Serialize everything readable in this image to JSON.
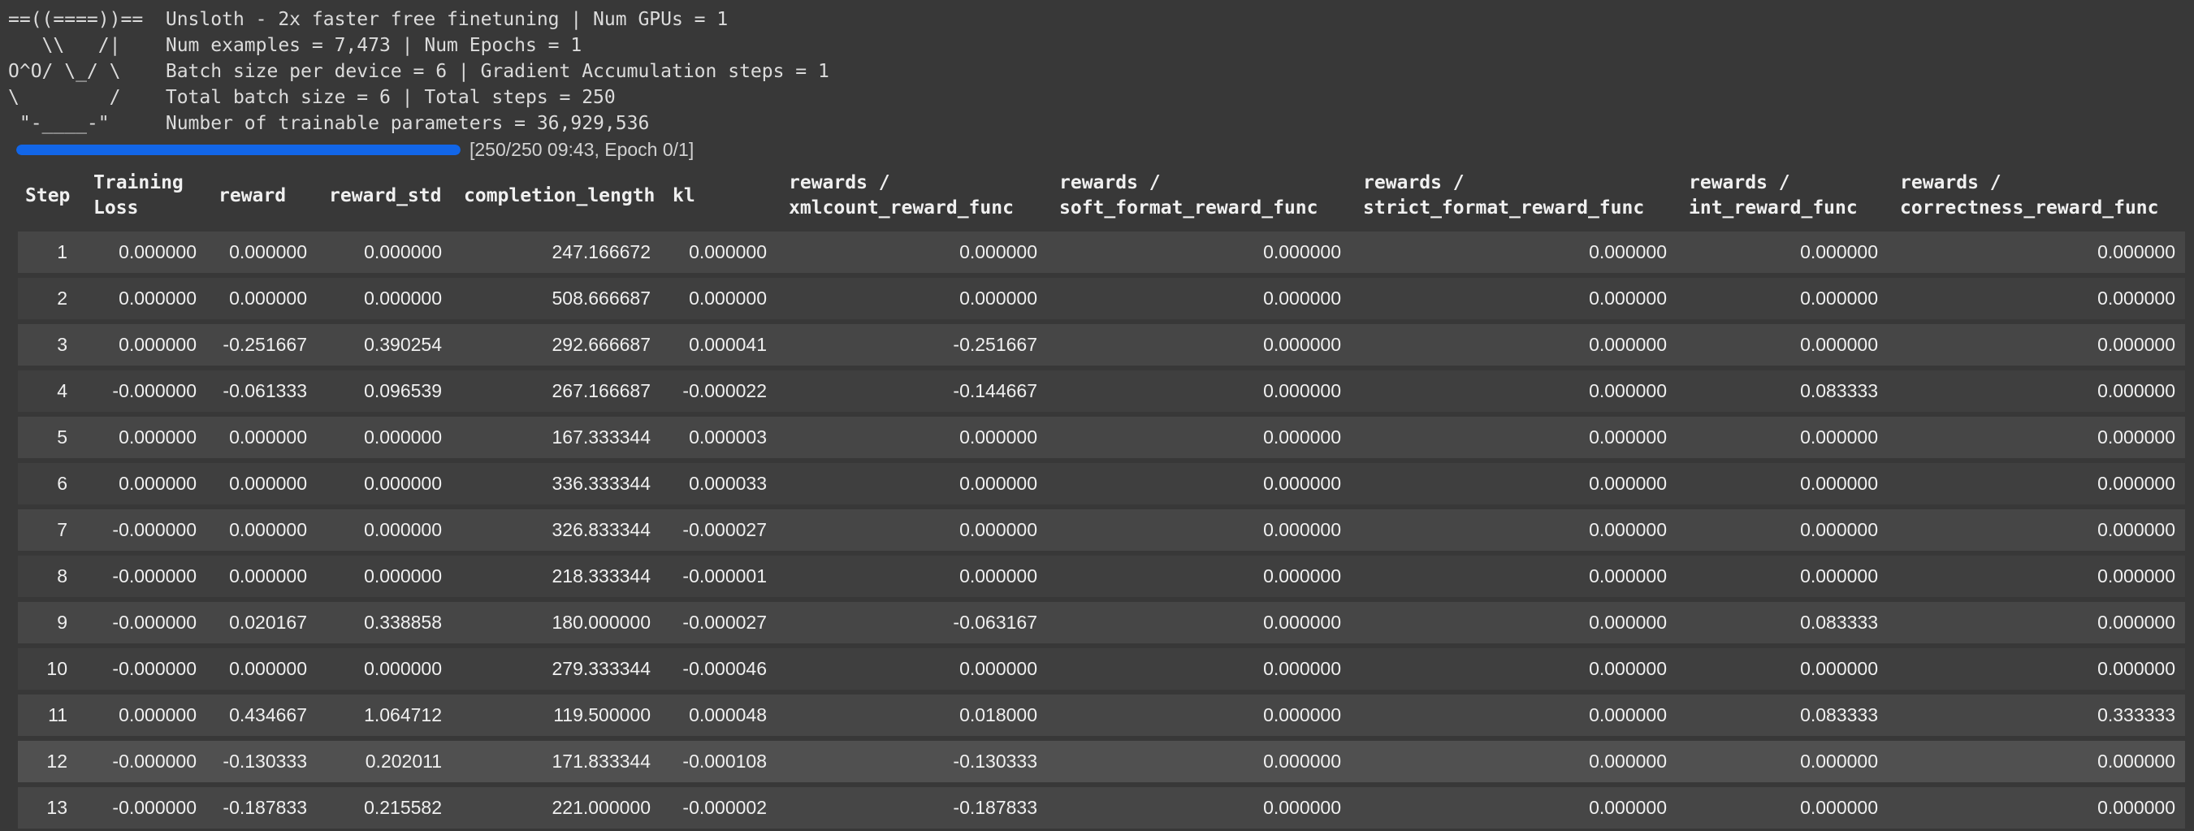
{
  "banner": {
    "ascii_art": [
      "==((====))==  Unsloth - 2x faster free finetuning | Num GPUs = 1",
      "   \\\\   /|    Num examples = 7,473 | Num Epochs = 1",
      "O^O/ \\_/ \\    Batch size per device = 6 | Gradient Accumulation steps = 1",
      "\\        /    Total batch size = 6 | Total steps = 250",
      " \"-____-\"     Number of trainable parameters = 36,929,536"
    ]
  },
  "progress": {
    "value": 250,
    "max": 250,
    "label": "[250/250 09:43, Epoch 0/1]",
    "bar_color": "#1266e8"
  },
  "table": {
    "column_keys": [
      "step",
      "training_loss",
      "reward",
      "reward_std",
      "completion_length",
      "kl",
      "rewards_xmlcount_reward_func",
      "rewards_soft_format_reward_func",
      "rewards_strict_format_reward_func",
      "rewards_int_reward_func",
      "rewards_correctness_reward_func"
    ],
    "columns": [
      {
        "label": "Step"
      },
      {
        "label": "Training\nLoss"
      },
      {
        "label": "reward"
      },
      {
        "label": "reward_std"
      },
      {
        "label": "completion_length"
      },
      {
        "label": "kl"
      },
      {
        "label": "rewards /\nxmlcount_reward_func"
      },
      {
        "label": "rewards /\nsoft_format_reward_func"
      },
      {
        "label": "rewards /\nstrict_format_reward_func"
      },
      {
        "label": "rewards /\nint_reward_func"
      },
      {
        "label": "rewards /\ncorrectness_reward_func"
      }
    ],
    "hover_step": "12",
    "rows": [
      [
        "1",
        "0.000000",
        "0.000000",
        "0.000000",
        "247.166672",
        "0.000000",
        "0.000000",
        "0.000000",
        "0.000000",
        "0.000000",
        "0.000000"
      ],
      [
        "2",
        "0.000000",
        "0.000000",
        "0.000000",
        "508.666687",
        "0.000000",
        "0.000000",
        "0.000000",
        "0.000000",
        "0.000000",
        "0.000000"
      ],
      [
        "3",
        "0.000000",
        "-0.251667",
        "0.390254",
        "292.666687",
        "0.000041",
        "-0.251667",
        "0.000000",
        "0.000000",
        "0.000000",
        "0.000000"
      ],
      [
        "4",
        "-0.000000",
        "-0.061333",
        "0.096539",
        "267.166687",
        "-0.000022",
        "-0.144667",
        "0.000000",
        "0.000000",
        "0.083333",
        "0.000000"
      ],
      [
        "5",
        "0.000000",
        "0.000000",
        "0.000000",
        "167.333344",
        "0.000003",
        "0.000000",
        "0.000000",
        "0.000000",
        "0.000000",
        "0.000000"
      ],
      [
        "6",
        "0.000000",
        "0.000000",
        "0.000000",
        "336.333344",
        "0.000033",
        "0.000000",
        "0.000000",
        "0.000000",
        "0.000000",
        "0.000000"
      ],
      [
        "7",
        "-0.000000",
        "0.000000",
        "0.000000",
        "326.833344",
        "-0.000027",
        "0.000000",
        "0.000000",
        "0.000000",
        "0.000000",
        "0.000000"
      ],
      [
        "8",
        "-0.000000",
        "0.000000",
        "0.000000",
        "218.333344",
        "-0.000001",
        "0.000000",
        "0.000000",
        "0.000000",
        "0.000000",
        "0.000000"
      ],
      [
        "9",
        "-0.000000",
        "0.020167",
        "0.338858",
        "180.000000",
        "-0.000027",
        "-0.063167",
        "0.000000",
        "0.000000",
        "0.083333",
        "0.000000"
      ],
      [
        "10",
        "-0.000000",
        "0.000000",
        "0.000000",
        "279.333344",
        "-0.000046",
        "0.000000",
        "0.000000",
        "0.000000",
        "0.000000",
        "0.000000"
      ],
      [
        "11",
        "0.000000",
        "0.434667",
        "1.064712",
        "119.500000",
        "0.000048",
        "0.018000",
        "0.000000",
        "0.000000",
        "0.083333",
        "0.333333"
      ],
      [
        "12",
        "-0.000000",
        "-0.130333",
        "0.202011",
        "171.833344",
        "-0.000108",
        "-0.130333",
        "0.000000",
        "0.000000",
        "0.000000",
        "0.000000"
      ],
      [
        "13",
        "-0.000000",
        "-0.187833",
        "0.215582",
        "221.000000",
        "-0.000002",
        "-0.187833",
        "0.000000",
        "0.000000",
        "0.000000",
        "0.000000"
      ]
    ]
  }
}
